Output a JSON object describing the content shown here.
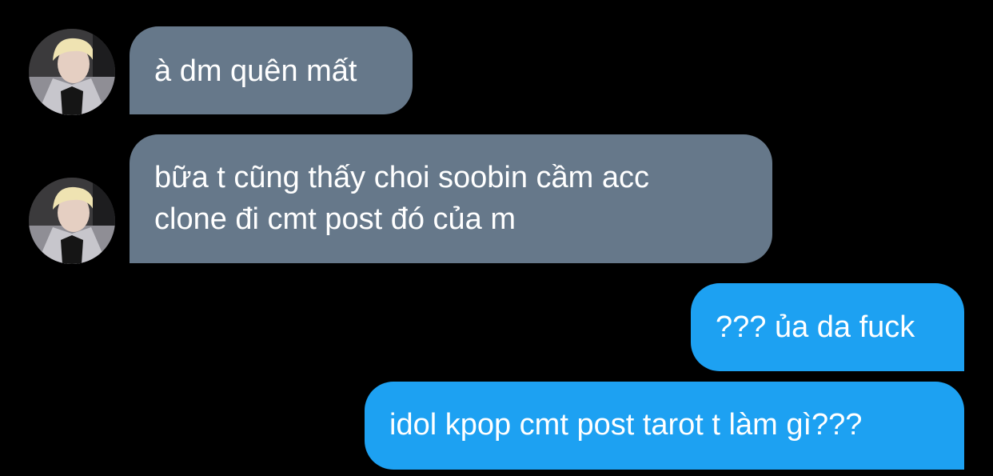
{
  "colors": {
    "background": "#000000",
    "received_bubble": "#66788a",
    "sent_bubble": "#1da1f2",
    "text": "#ffffff"
  },
  "messages": [
    {
      "direction": "received",
      "lines": [
        "à dm quên mất"
      ],
      "avatar": "contact-photo"
    },
    {
      "direction": "received",
      "lines": [
        "bữa t cũng thấy choi soobin cầm acc",
        "clone đi cmt post đó của m"
      ],
      "avatar": "contact-photo"
    },
    {
      "direction": "sent",
      "lines": [
        "??? ủa da fuck"
      ]
    },
    {
      "direction": "sent",
      "lines": [
        "idol kpop cmt post tarot t làm gì???"
      ]
    }
  ]
}
